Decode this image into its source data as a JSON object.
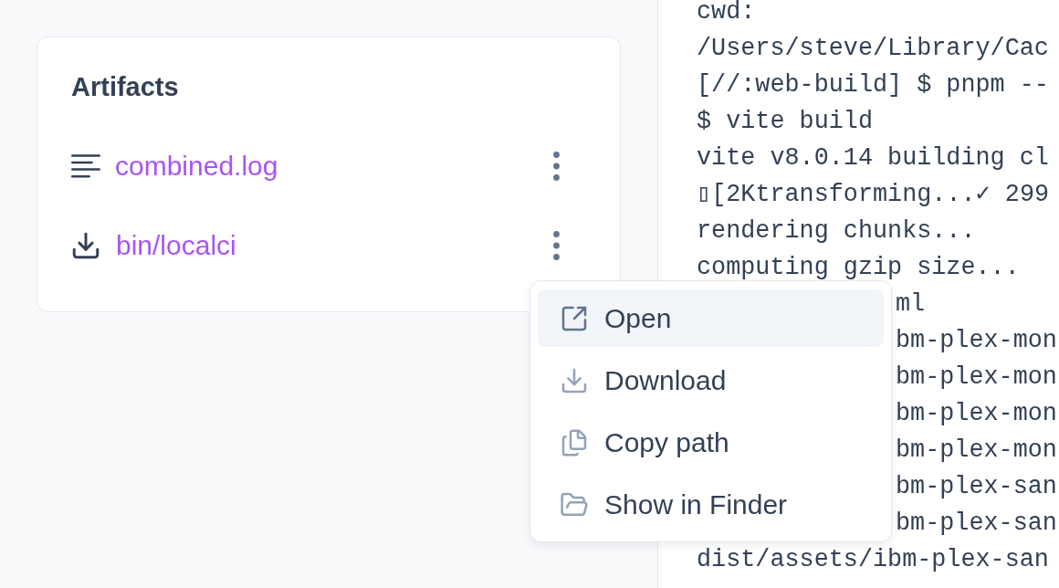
{
  "artifacts": {
    "title": "Artifacts",
    "items": [
      {
        "kind": "log",
        "name": "combined.log"
      },
      {
        "kind": "download",
        "name": "bin/localci"
      }
    ]
  },
  "context_menu": {
    "items": [
      {
        "kind": "open",
        "label": "Open",
        "selected": true
      },
      {
        "kind": "download",
        "label": "Download",
        "selected": false
      },
      {
        "kind": "copy",
        "label": "Copy path",
        "selected": false
      },
      {
        "kind": "folder",
        "label": "Show in Finder",
        "selected": false
      }
    ]
  },
  "terminal": {
    "lines": [
      {
        "kind": "full",
        "text": "cwd:"
      },
      {
        "kind": "full",
        "text": "/Users/steve/Library/Cac"
      },
      {
        "kind": "full",
        "text": "[//:web-build] $ pnpm --"
      },
      {
        "kind": "full",
        "text": "$ vite build"
      },
      {
        "kind": "full",
        "text": "vite v8.0.14 building cl"
      },
      {
        "kind": "full",
        "text": "▯[2Ktransforming...✓ 299"
      },
      {
        "kind": "full",
        "text": "rendering chunks..."
      },
      {
        "kind": "full",
        "text": "computing gzip size..."
      },
      {
        "kind": "covered",
        "text": "ml"
      },
      {
        "kind": "covered",
        "text": "bm-plex-mon"
      },
      {
        "kind": "covered",
        "text": "bm-plex-mon"
      },
      {
        "kind": "covered",
        "text": "bm-plex-mon"
      },
      {
        "kind": "covered",
        "text": "bm-plex-mon"
      },
      {
        "kind": "covered",
        "text": "bm-plex-san"
      },
      {
        "kind": "covered",
        "text": "bm-plex-san"
      },
      {
        "kind": "full",
        "text": "dist/assets/ibm-plex-san"
      }
    ]
  }
}
